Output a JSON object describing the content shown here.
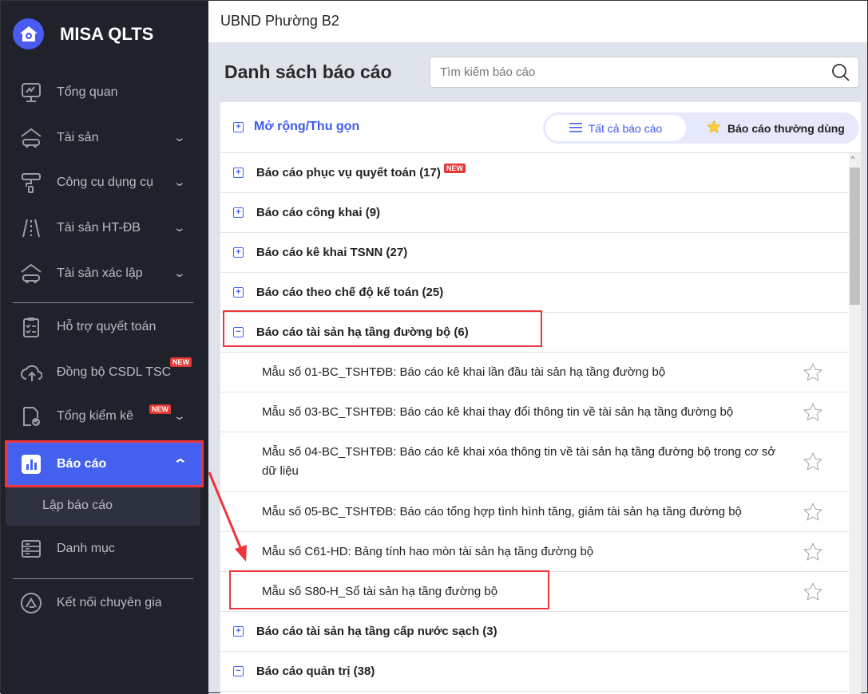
{
  "app": {
    "name": "MISA QLTS"
  },
  "sidebar": {
    "items": [
      {
        "label": "Tổng quan",
        "icon": "monitor-chart-icon"
      },
      {
        "label": "Tài sản",
        "icon": "house-car-icon",
        "chevron": true
      },
      {
        "label": "Công cụ dụng cụ",
        "icon": "paint-roller-icon",
        "chevron": true
      },
      {
        "label": "Tài sản HT-ĐB",
        "icon": "road-icon",
        "chevron": true
      },
      {
        "label": "Tài sản xác lập",
        "icon": "house-car-icon",
        "chevron": true
      },
      {
        "label": "Hỗ trợ quyết toán",
        "icon": "clipboard-check-icon"
      },
      {
        "label": "Đồng bộ CSDL TSC",
        "icon": "cloud-upload-icon",
        "badge": "NEW"
      },
      {
        "label": "Tổng kiểm kê",
        "icon": "document-check-icon",
        "badge": "NEW",
        "chevron": true
      },
      {
        "label": "Báo cáo",
        "icon": "bar-chart-icon",
        "active": true
      },
      {
        "label": "Danh mục",
        "icon": "server-list-icon"
      },
      {
        "label": "Kết nối chuyên gia",
        "icon": "expert-logo-icon"
      }
    ],
    "sub_item": "Lập báo cáo"
  },
  "header": {
    "org": "UBND Phường B2"
  },
  "page": {
    "title": "Danh sách báo cáo",
    "search_placeholder": "Tìm kiếm báo cáo"
  },
  "toolbar": {
    "expand_label": "Mở rộng/Thu gọn",
    "tab_all": "Tất cả báo cáo",
    "tab_fav": "Báo cáo thường dùng"
  },
  "rows": [
    {
      "type": "group",
      "label": "Báo cáo phục vụ quyết toán (17)",
      "badge": "NEW",
      "expanded": false
    },
    {
      "type": "group",
      "label": "Báo cáo công khai (9)",
      "expanded": false
    },
    {
      "type": "group",
      "label": "Báo cáo kê khai TSNN (27)",
      "expanded": false
    },
    {
      "type": "group",
      "label": "Báo cáo theo chế độ kế toán (25)",
      "expanded": false
    },
    {
      "type": "group",
      "label": "Báo cáo tài sản hạ tầng đường bộ (6)",
      "expanded": true
    },
    {
      "type": "item",
      "label": "Mẫu số 01-BC_TSHTĐB: Báo cáo kê khai lần đầu tài sản hạ tầng đường bộ"
    },
    {
      "type": "item",
      "label": "Mẫu số 03-BC_TSHTĐB: Báo cáo kê khai thay đổi thông tin về tài sản hạ tầng đường bộ"
    },
    {
      "type": "item",
      "label": "Mẫu số 04-BC_TSHTĐB: Báo cáo kê khai xóa thông tin về tài sản hạ tầng đường bộ trong cơ sở dữ liệu",
      "tall": true
    },
    {
      "type": "item",
      "label": "Mẫu số 05-BC_TSHTĐB: Báo cáo tổng hợp tình hình tăng, giảm tài sản hạ tầng đường bộ"
    },
    {
      "type": "item",
      "label": "Mẫu số C61-HD: Bảng tính hao mòn tài sản hạ tầng đường bộ"
    },
    {
      "type": "item",
      "label": "Mẫu số S80-H_Sổ tài sản hạ tầng đường bộ"
    },
    {
      "type": "group",
      "label": "Báo cáo tài sản hạ tầng cấp nước sạch (3)",
      "expanded": false
    },
    {
      "type": "group",
      "label": "Báo cáo quản trị (38)",
      "expanded": true
    }
  ],
  "colors": {
    "accent": "#4361ee",
    "sidebar": "#1f222b",
    "highlight": "#f0343c"
  }
}
